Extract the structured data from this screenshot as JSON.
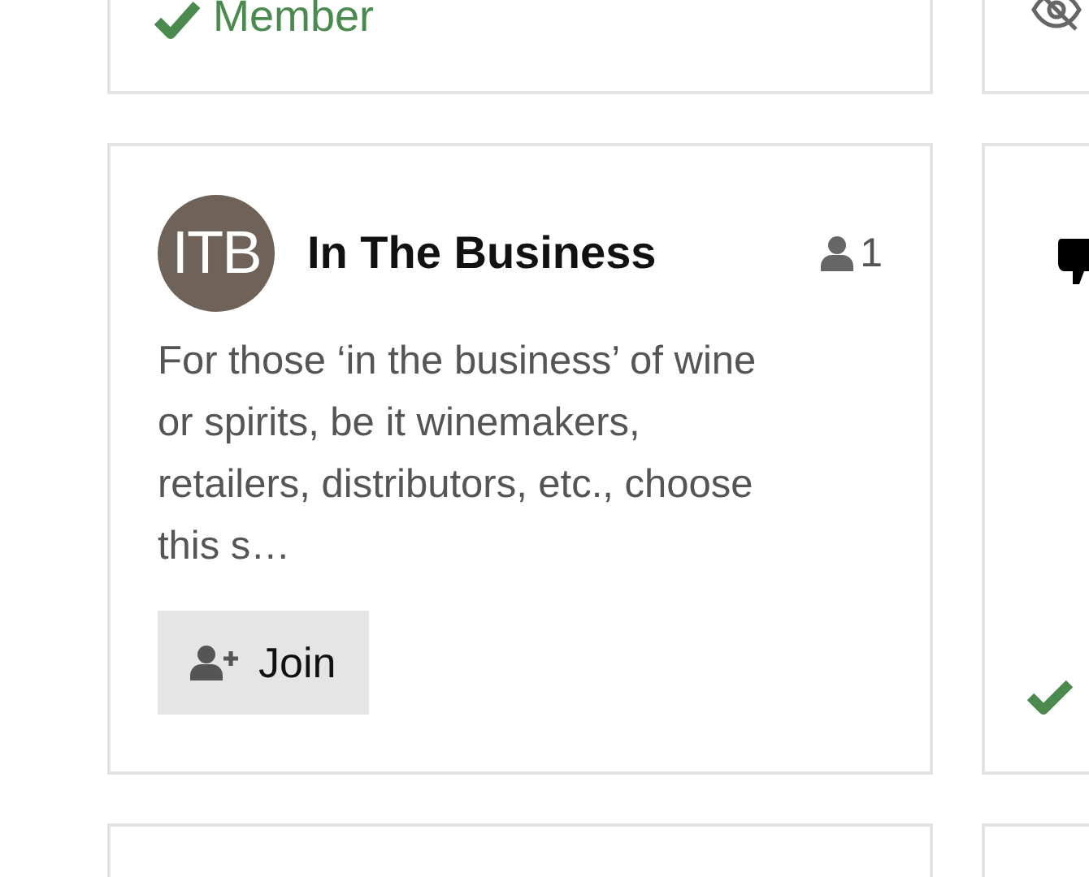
{
  "left_cards": [
    {
      "kind": "member_status",
      "label": "Member"
    },
    {
      "kind": "group",
      "avatar": "ITB",
      "name": "In The Business",
      "member_count": "1",
      "description": "For those ‘in the business’ of wine or spirits, be it winemakers, retailers, distributors, etc., choose this s…",
      "button": "Join"
    },
    {
      "kind": "empty"
    }
  ],
  "right_cards": [
    {
      "kind": "hidden"
    },
    {
      "kind": "member_partial"
    },
    {
      "kind": "empty"
    }
  ]
}
